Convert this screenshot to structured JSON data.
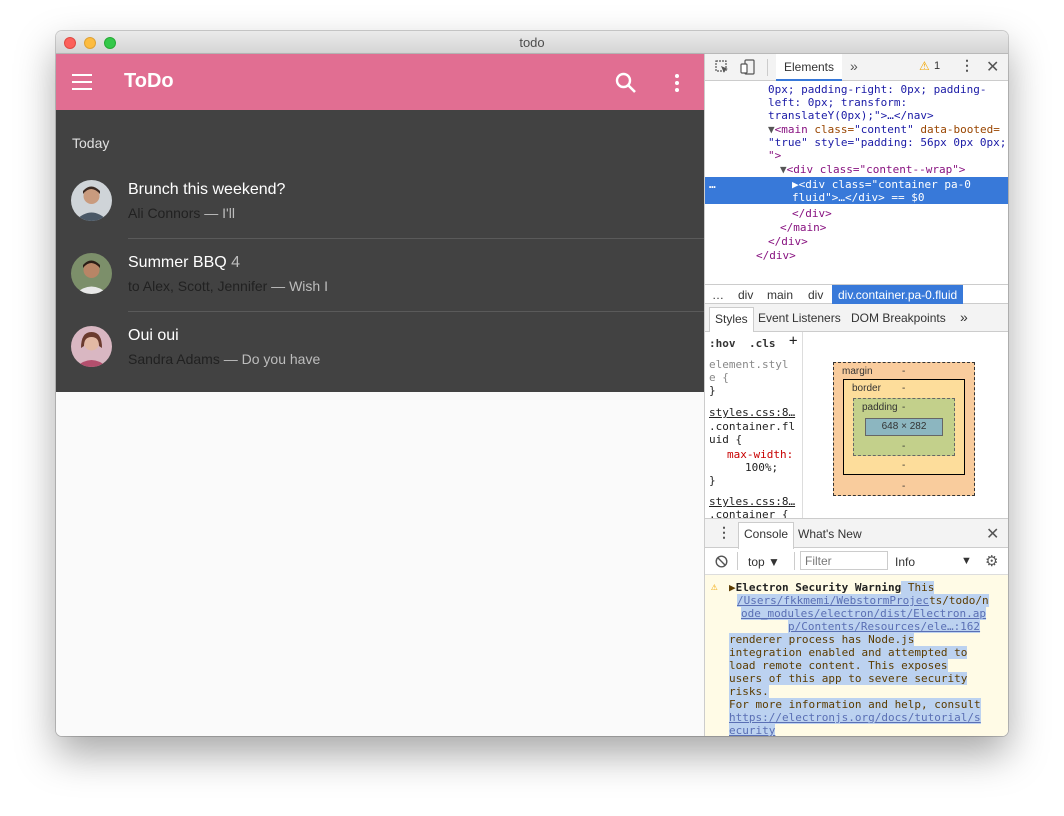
{
  "window": {
    "title": "todo"
  },
  "app": {
    "title": "ToDo",
    "subheader": "Today",
    "items": [
      {
        "title": "Brunch this weekend?",
        "count": "",
        "who": "Ali Connors",
        "snippet": " — I'll"
      },
      {
        "title": "Summer BBQ",
        "count": "4",
        "who": "to Alex, Scott, Jennifer",
        "snippet": " — Wish I"
      },
      {
        "title": "Oui oui",
        "count": "",
        "who": "Sandra Adams",
        "snippet": " — Do you have"
      }
    ],
    "colors": {
      "toolbar": "#e16e92",
      "list_bg": "#424242"
    }
  },
  "devtools": {
    "tab_elements": "Elements",
    "warning_count": "1",
    "dom": {
      "l1": "0px; padding-right: 0px; padding-",
      "l2": "left: 0px; transform:",
      "l3": "translateY(0px);\">…</nav>",
      "l4_tag": "<main",
      "l4_attr": " class=",
      "l4_val": "\"content\"",
      "l4_attr2": " data-booted=",
      "l5": "\"true\" style=\"padding: 56px 0px 0px;",
      "l6": "\">",
      "l7": "<div class=\"content--wrap\">",
      "sel1": "<div class=\"container pa-0",
      "sel2": "fluid\">…</div> == $0",
      "l8": "</div>",
      "l9": "</main>",
      "l10": "</div>",
      "l11": "</div>"
    },
    "breadcrumbs": [
      "…",
      "div",
      "main",
      "div",
      "div.container.pa-0.fluid"
    ],
    "styles_tabs": [
      "Styles",
      "Event Listeners",
      "DOM Breakpoints"
    ],
    "styles": {
      "hov": ":hov",
      "cls": ".cls",
      "l1": "element.styl",
      "l2": "e {",
      "l3": "}",
      "l4": "styles.css:8…",
      "l5": ".container.fl",
      "l6": "uid {",
      "l7": "max-width:",
      "l8": "100%;",
      "l9": "}",
      "l10": "styles.css:8…",
      "l11": ".container {"
    },
    "box_model": {
      "margin": "margin",
      "border": "border",
      "padding": "padding",
      "content": "648 × 282",
      "dash": "-"
    },
    "drawer_tabs": [
      "Console",
      "What's New"
    ],
    "console_toolbar": {
      "context": "top",
      "filter_placeholder": "Filter",
      "level": "Info"
    },
    "console": {
      "title": "Electron Security Warning",
      "after_title": " This",
      "link1a": "/Users/fkkmemi/WebstormProjec",
      "link1b": "ts/todo/n",
      "link2": "ode_modules/electron/dist/Electron.ap",
      "link3": "p/Contents/Resources/ele…:162",
      "t1": "renderer process has Node.js",
      "t2": "integration enabled and attempted to",
      "t3": "load remote content. This exposes",
      "t4": "users of this app to severe security",
      "t5": "risks.",
      "t6": "For more information and help, consult",
      "t7": "https://electronjs.org/docs/tutorial/s",
      "t8": "ecurity"
    }
  }
}
